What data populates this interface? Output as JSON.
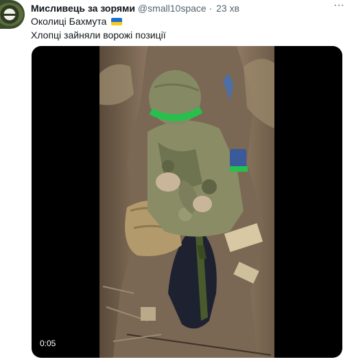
{
  "tweet": {
    "author_name": "Мисливець за зорями",
    "author_handle": "@small10space",
    "separator": "·",
    "time": "23 хв",
    "more_label": "···",
    "text_lines": [
      "Околиці Бахмута",
      "Хлопці зайняли ворожі позиції"
    ],
    "flag_name": "ukraine-flag",
    "flag_colors": [
      "#1d6fd1",
      "#f5cd1a"
    ]
  },
  "media": {
    "type": "video",
    "duration": "0:05"
  },
  "colors": {
    "text": "#0f1419",
    "secondary": "#536471",
    "helmet_band": "#27c04d",
    "video_bg": "#000000"
  }
}
